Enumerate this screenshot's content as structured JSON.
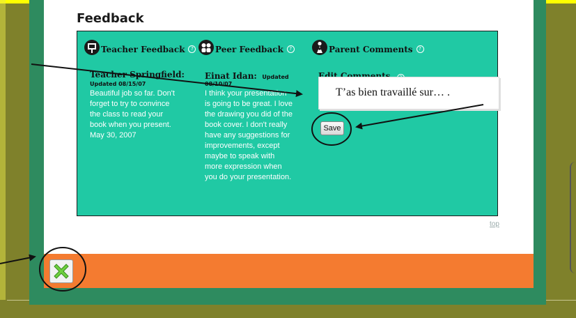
{
  "page": {
    "title": "Feedback"
  },
  "columns": [
    {
      "id": "teacher",
      "header": "Teacher Feedback",
      "icon": "whiteboard-icon",
      "author": "Teacher Springfield:",
      "updated": "Updated 08/15/07",
      "lines": [
        "Beautiful job so far. Don't",
        "forget to try to convince",
        "the class to read your",
        "book when you present.",
        "May 30, 2007"
      ]
    },
    {
      "id": "peer",
      "header": "Peer Feedback",
      "icon": "two-people-icon",
      "author": "Einat Idan:",
      "updated_inline": "Updated",
      "updated": "08/10/07",
      "lines": [
        "I think your presentation",
        "is going to be great. I love",
        "the drawing you did of the",
        "book cover. I don't really",
        "have any suggestions for",
        "improvements, except",
        "maybe to speak with",
        "more expression when",
        "you do your presentation."
      ]
    },
    {
      "id": "parent",
      "header": "Parent Comments",
      "icon": "parent-child-icon",
      "edit_label": "Edit Comments"
    }
  ],
  "help_glyph": "?",
  "comment": {
    "text": "T’as bien travaillé sur… ."
  },
  "save_label": "Save",
  "top_link": "top",
  "close_icon": "green-x-icon",
  "colors": {
    "teal": "#20c9a4",
    "orange": "#f47b30",
    "frame_green": "#2e8b5f",
    "olive": "#7f812b"
  }
}
